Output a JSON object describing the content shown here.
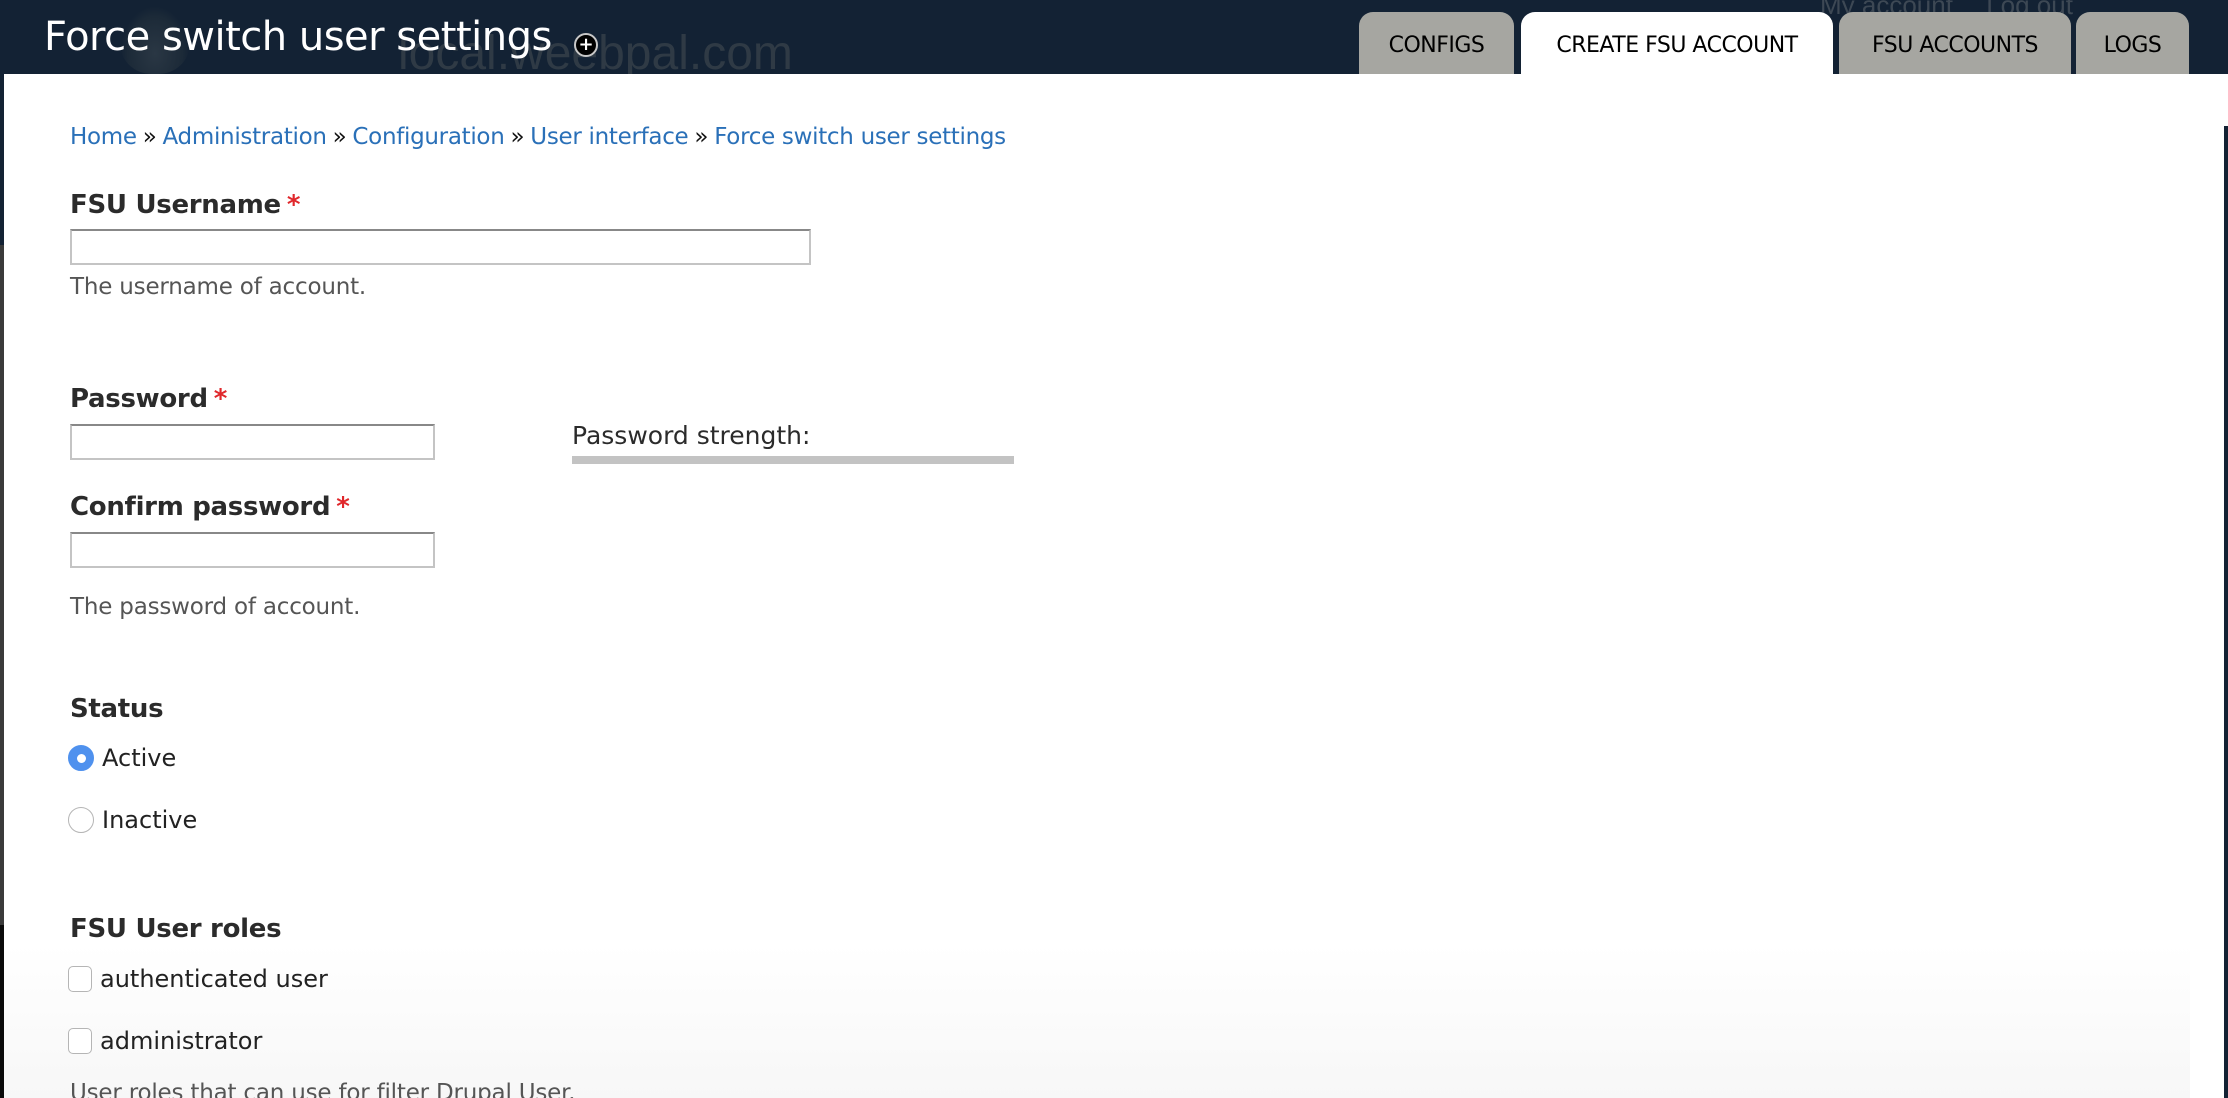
{
  "header": {
    "title": "Force switch user settings",
    "watermark": "local.weebpal.com",
    "shortcut_icon": "plus-circle-icon",
    "user_links": [
      "My account",
      "Log out"
    ]
  },
  "tabs": [
    {
      "label": "CONFIGS",
      "active": false
    },
    {
      "label": "CREATE FSU ACCOUNT",
      "active": true
    },
    {
      "label": "FSU ACCOUNTS",
      "active": false
    },
    {
      "label": "LOGS",
      "active": false
    }
  ],
  "breadcrumb": {
    "separator": "»",
    "items": [
      "Home",
      "Administration",
      "Configuration",
      "User interface",
      "Force switch user settings"
    ]
  },
  "form": {
    "required_marker": "*",
    "username": {
      "label": "FSU Username",
      "value": "",
      "description": "The username of account."
    },
    "password": {
      "label": "Password",
      "value": "",
      "strength_label": "Password strength:",
      "strength_percent": 0
    },
    "confirm_password": {
      "label": "Confirm password",
      "value": "",
      "description": "The password of account."
    },
    "status": {
      "label": "Status",
      "options": [
        {
          "label": "Active",
          "checked": true
        },
        {
          "label": "Inactive",
          "checked": false
        }
      ]
    },
    "roles": {
      "label": "FSU User roles",
      "options": [
        {
          "label": "authenticated user",
          "checked": false
        },
        {
          "label": "administrator",
          "checked": false
        }
      ],
      "description": "User roles that can use for filter Drupal User."
    }
  },
  "colors": {
    "header_bg": "#132234",
    "tab_bg": "#a6a6a1",
    "tab_active_bg": "#ffffff",
    "link": "#2a70b8",
    "required": "#e0282c",
    "radio_checked": "#4f91ee"
  }
}
